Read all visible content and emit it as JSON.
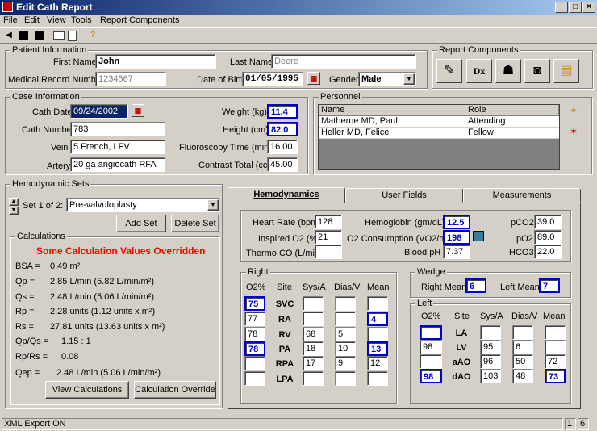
{
  "window": {
    "title": "Edit Cath Report",
    "min": "_",
    "max": "□",
    "close": "×"
  },
  "menu": [
    "File",
    "Edit",
    "View",
    "Tools",
    "Report Components"
  ],
  "patient": {
    "legend": "Patient Information",
    "first_name_label": "First Name",
    "first_name": "John",
    "last_name_label": "Last Name",
    "last_name": "Deere",
    "mrn_label": "Medical Record Number",
    "mrn": "1234567",
    "dob_label": "Date of Birth",
    "dob": "01/05/1995",
    "gender_label": "Gender",
    "gender": "Male"
  },
  "report_components": {
    "legend": "Report Components",
    "dx": "Dx"
  },
  "case": {
    "legend": "Case Information",
    "cath_date_label": "Cath Date",
    "cath_date": "09/24/2002",
    "cath_number_label": "Cath Number",
    "cath_number": "783",
    "vein_label": "Vein",
    "vein": "5 French, LFV",
    "artery_label": "Artery",
    "artery": "20 ga angiocath RFA",
    "weight_label": "Weight (kg)",
    "weight": "11.4",
    "height_label": "Height (cm)",
    "height": "82.0",
    "fluoro_label": "Fluoroscopy Time (min)",
    "fluoro": "16.00",
    "contrast_label": "Contrast Total (cc)",
    "contrast": "45.00"
  },
  "personnel": {
    "legend": "Personnel",
    "headers": [
      "Name",
      "Role"
    ],
    "rows": [
      {
        "name": "Matherne MD, Paul",
        "role": "Attending"
      },
      {
        "name": "Heller MD, Felice",
        "role": "Fellow"
      }
    ]
  },
  "hemo_sets": {
    "legend": "Hemodynamic Sets",
    "set_label": "Set 1 of 2:",
    "set_value": "Pre-valvuloplasty",
    "add": "Add Set",
    "delete": "Delete Set"
  },
  "calculations": {
    "legend": "Calculations",
    "warning": "Some Calculation Values Overridden",
    "rows": [
      {
        "k": "BSA =",
        "v": "0.49 m²"
      },
      {
        "k": "Qp =",
        "v": "2.85 L/min (5.82 L/min/m²)"
      },
      {
        "k": "Qs =",
        "v": "2.48 L/min (5.06 L/min/m²)"
      },
      {
        "k": "Rp =",
        "v": "2.28 units (1.12 units x m²)"
      },
      {
        "k": "Rs =",
        "v": "27.81 units (13.63 units x m²)"
      },
      {
        "k": "Qp/Qs =",
        "v": "1.15 : 1"
      },
      {
        "k": "Rp/Rs =",
        "v": "0.08"
      },
      {
        "k": "Qep =",
        "v": "2.48 L/min (5.06 L/min/m²)"
      }
    ],
    "view": "View Calculations",
    "override": "Calculation Override"
  },
  "tabs": [
    "Hemodynamics",
    "User Fields",
    "Measurements"
  ],
  "hemo": {
    "hr_label": "Heart Rate (bpm)",
    "hr": "128",
    "io2_label": "Inspired O2 (%)",
    "io2": "21",
    "tco_label": "Thermo CO (L/min)",
    "tco": "",
    "hgb_label": "Hemoglobin (gm/dL)",
    "hgb": "12.5",
    "vo2_label": "O2 Consumption (VO2/m²)",
    "vo2": "198",
    "ph_label": "Blood pH",
    "ph": "7.37",
    "pco2_label": "pCO2",
    "pco2": "39.0",
    "po2_label": "pO2",
    "po2": "89.0",
    "hco3_label": "HCO3",
    "hco3": "22.0"
  },
  "right": {
    "legend": "Right",
    "headers": [
      "O2%",
      "Site",
      "Sys/A",
      "Dias/V",
      "Mean"
    ],
    "rows": [
      {
        "o2": "75",
        "site": "SVC",
        "sys": "",
        "dias": "",
        "mean": ""
      },
      {
        "o2": "77",
        "site": "RA",
        "sys": "",
        "dias": "",
        "mean": "4"
      },
      {
        "o2": "78",
        "site": "RV",
        "sys": "68",
        "dias": "5",
        "mean": ""
      },
      {
        "o2": "78",
        "site": "PA",
        "sys": "18",
        "dias": "10",
        "mean": "13"
      },
      {
        "o2": "",
        "site": "RPA",
        "sys": "17",
        "dias": "9",
        "mean": "12"
      },
      {
        "o2": "",
        "site": "LPA",
        "sys": "",
        "dias": "",
        "mean": ""
      }
    ]
  },
  "wedge": {
    "legend": "Wedge",
    "right_label": "Right Mean",
    "right": "6",
    "left_label": "Left Mean",
    "left": "7"
  },
  "left": {
    "legend": "Left",
    "headers": [
      "O2%",
      "Site",
      "Sys/A",
      "Dias/V",
      "Mean"
    ],
    "rows": [
      {
        "o2": "",
        "site": "LA",
        "sys": "",
        "dias": "",
        "mean": ""
      },
      {
        "o2": "98",
        "site": "LV",
        "sys": "95",
        "dias": "6",
        "mean": ""
      },
      {
        "o2": "",
        "site": "aAO",
        "sys": "96",
        "dias": "50",
        "mean": "72"
      },
      {
        "o2": "98",
        "site": "dAO",
        "sys": "103",
        "dias": "48",
        "mean": "73"
      }
    ]
  },
  "status": {
    "left": "XML Export ON",
    "a": "1",
    "b": "6"
  }
}
